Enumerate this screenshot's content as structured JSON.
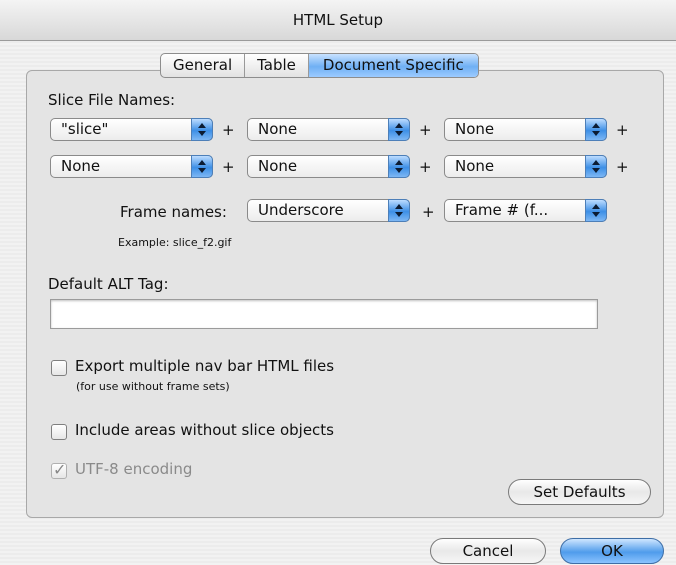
{
  "window": {
    "title": "HTML Setup"
  },
  "tabs": [
    "General",
    "Table",
    "Document Specific"
  ],
  "slice_file_names": {
    "label": "Slice File Names:",
    "row1": [
      "\"slice\"",
      "None",
      "None"
    ],
    "row2": [
      "None",
      "None",
      "None"
    ],
    "plus": "+"
  },
  "frame_names": {
    "label": "Frame names:",
    "values": [
      "Underscore",
      "Frame # (f..."
    ],
    "example": "Example: slice_f2.gif"
  },
  "alt_tag": {
    "label": "Default ALT Tag:",
    "value": ""
  },
  "options": {
    "export_nav_bar": {
      "label": "Export multiple nav bar HTML files",
      "note": "(for use without frame sets)",
      "checked": false
    },
    "include_areas": {
      "label": "Include areas without slice objects",
      "checked": false
    },
    "utf8": {
      "label": "UTF-8 encoding",
      "checked": true,
      "disabled": true
    }
  },
  "buttons": {
    "set_defaults": "Set Defaults",
    "cancel": "Cancel",
    "ok": "OK"
  },
  "colors": {
    "accent": "#4f9ceb",
    "window_bg": "#ececec"
  }
}
